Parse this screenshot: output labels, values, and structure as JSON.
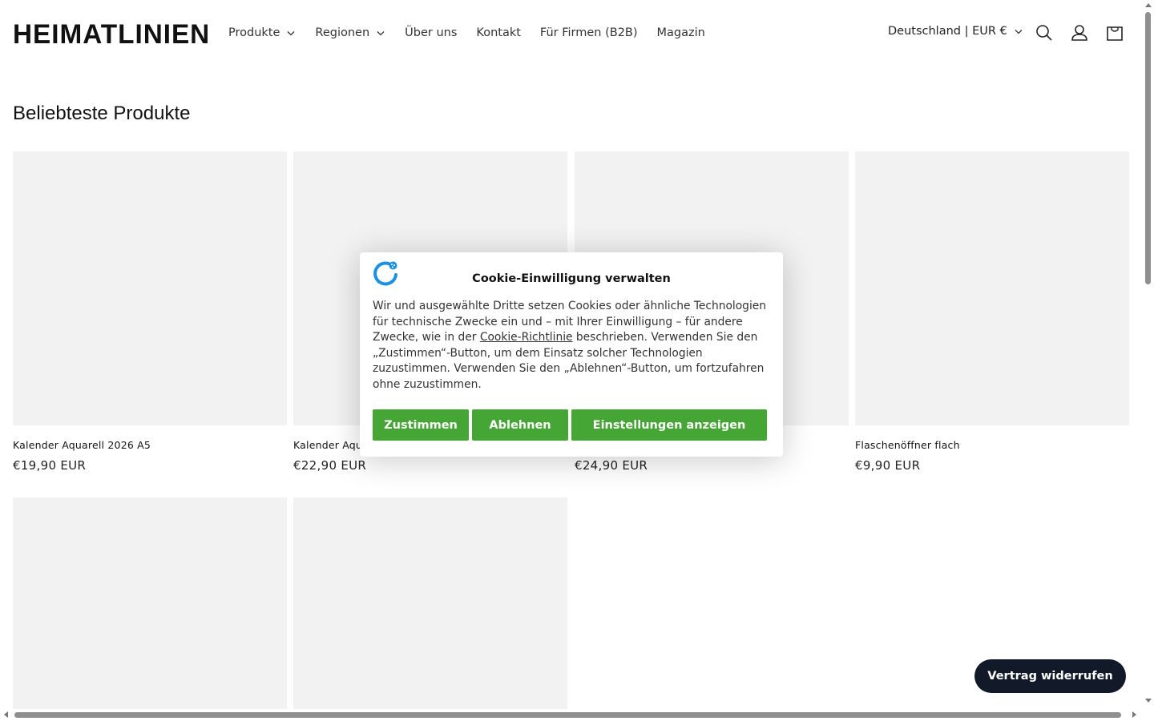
{
  "header": {
    "logo": "HEIMATLINIEN",
    "nav": [
      {
        "label": "Produkte",
        "dropdown": true
      },
      {
        "label": "Regionen",
        "dropdown": true
      },
      {
        "label": "Über uns",
        "dropdown": false
      },
      {
        "label": "Kontakt",
        "dropdown": false
      },
      {
        "label": "Für Firmen (B2B)",
        "dropdown": false
      },
      {
        "label": "Magazin",
        "dropdown": false
      }
    ],
    "country_selector": "Deutschland | EUR €",
    "icons": [
      "search-icon",
      "account-icon",
      "cart-icon"
    ]
  },
  "section": {
    "title": "Beliebteste Produkte"
  },
  "products": [
    {
      "name": "Kalender Aquarell 2026 A5",
      "price": "€19,90 EUR"
    },
    {
      "name": "Kalender Aqu",
      "price": "€22,90 EUR"
    },
    {
      "name": "",
      "price": "€24,90 EUR"
    },
    {
      "name": "Flaschenöffner flach",
      "price": "€9,90 EUR"
    }
  ],
  "cookie_modal": {
    "title": "Cookie-Einwilligung verwalten",
    "text_before_link": "Wir und ausgewählte Dritte setzen Cookies oder ähnliche Technologien für technische Zwecke ein und – mit Ihrer Einwilligung – für andere Zwecke, wie in der ",
    "link": "Cookie-Richtlinie",
    "text_after_link": " beschrieben. Verwenden Sie den „Zustimmen“-Button, um dem Einsatz solcher Technologien zuzustimmen. Verwenden Sie den „Ablehnen“-Button, um fortzufahren ohne zuzustimmen.",
    "accept": "Zustimmen",
    "reject": "Ablehnen",
    "settings": "Einstellungen anzeigen",
    "button_color": "#45a535"
  },
  "withdraw_button": "Vertrag widerrufen",
  "colors": {
    "placeholder": "#f2f2f2",
    "withdraw_bg": "#121a2a"
  }
}
